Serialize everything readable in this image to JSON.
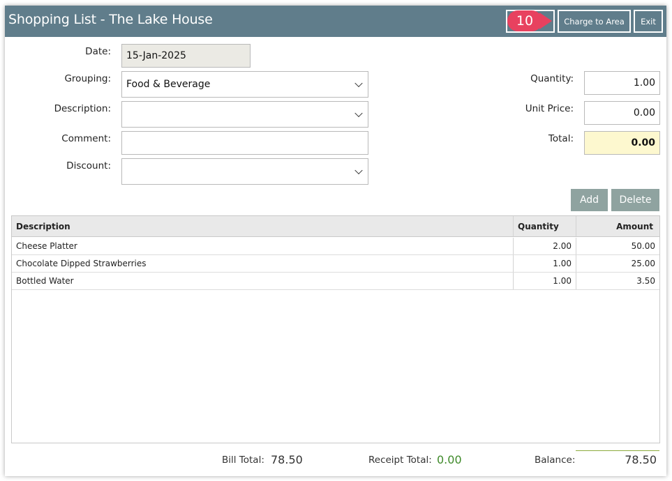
{
  "window": {
    "title": "Shopping List - The Lake House",
    "callout_number": "10",
    "charge_label": "Charge to Area",
    "exit_label": "Exit"
  },
  "form": {
    "date_label": "Date:",
    "date_value": "15-Jan-2025",
    "grouping_label": "Grouping:",
    "grouping_value": "Food & Beverage",
    "description_label": "Description:",
    "description_value": "",
    "comment_label": "Comment:",
    "comment_value": "",
    "discount_label": "Discount:",
    "discount_value": "",
    "quantity_label": "Quantity:",
    "quantity_value": "1.00",
    "unit_price_label": "Unit Price:",
    "unit_price_value": "0.00",
    "total_label": "Total:",
    "total_value": "0.00"
  },
  "actions": {
    "add_label": "Add",
    "delete_label": "Delete"
  },
  "table": {
    "headers": {
      "description": "Description",
      "quantity": "Quantity",
      "amount": "Amount"
    },
    "rows": [
      {
        "description": "Cheese Platter",
        "quantity": "2.00",
        "amount": "50.00"
      },
      {
        "description": "Chocolate Dipped Strawberries",
        "quantity": "1.00",
        "amount": "25.00"
      },
      {
        "description": "Bottled Water",
        "quantity": "1.00",
        "amount": "3.50"
      }
    ]
  },
  "footer": {
    "bill_total_label": "Bill Total:",
    "bill_total_value": "78.50",
    "receipt_total_label": "Receipt Total:",
    "receipt_total_value": "0.00",
    "balance_label": "Balance:",
    "balance_value": "78.50"
  },
  "colors": {
    "titlebar": "#607d8b",
    "callout": "#e8415f",
    "action_button": "#8fa3a0",
    "total_highlight": "#fdf8cf",
    "receipt_green": "#3f8a2a"
  }
}
